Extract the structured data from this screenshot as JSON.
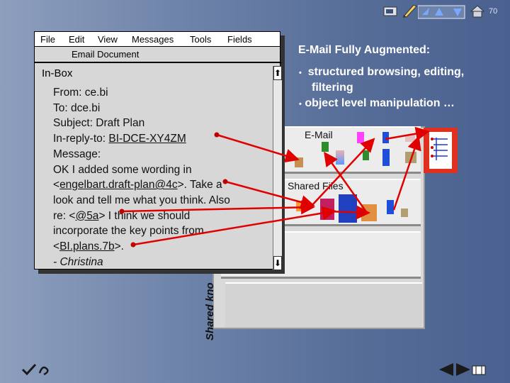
{
  "page": {
    "number": "70"
  },
  "window": {
    "menu": [
      "File",
      "Edit",
      "View",
      "Messages",
      "Tools",
      "Fields"
    ],
    "title": "Email Document",
    "folder": "In-Box",
    "message": {
      "from": "From: ce.bi",
      "to": "To: dce.bi",
      "subject": "Subject: Draft Plan",
      "in_reply_to_prefix": "In-reply-to: ",
      "in_reply_to_link": "BI-DCE-XY4ZM",
      "message_label": "Message:",
      "line1": "OK I added some wording in",
      "line2_pre": "<",
      "line2_link": "engelbart.draft-plan@4c",
      "line2_post": ">.  Take a",
      "line3": "look and tell me what you think.  Also",
      "line4_pre": "re: <",
      "line4_link": "@5a",
      "line4_post": "> I think we should",
      "line5": "incorporate the key points from",
      "line6_pre": "<",
      "line6_link": "BI.plans.7b",
      "line6_post": ">.",
      "signature": "- Christina"
    }
  },
  "slide": {
    "heading": "E-Mail Fully Augmented:",
    "bullets": [
      "structured browsing, editing,",
      "filtering",
      "object level manipulation …"
    ],
    "bullet_char": "•"
  },
  "knowledge_base": {
    "vertical_label": "Shared kno",
    "shelf_email": "E-Mail",
    "shelf_files": "Shared Files"
  },
  "icons": [
    "hand-pointer-icon",
    "pencil-icon",
    "nav-arrows-icon",
    "home-icon",
    "checkmark-icon",
    "prev-arrow-icon",
    "next-arrow-icon",
    "film-icon"
  ],
  "colors": {
    "arrow": "#e00000",
    "background": "#6f84aa"
  }
}
